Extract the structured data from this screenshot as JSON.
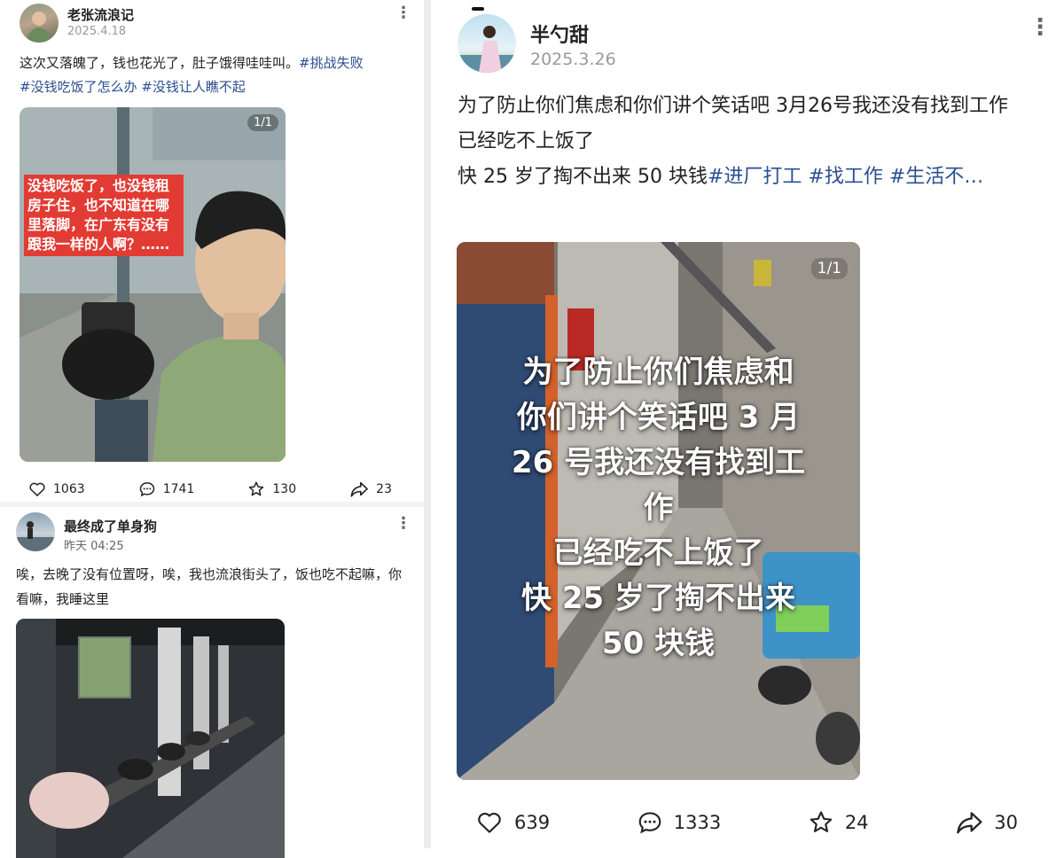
{
  "posts": [
    {
      "author": "老张流浪记",
      "date": "2025.4.18",
      "text": "这次又落魄了，钱也花光了，肚子饿得哇哇叫。",
      "tags": [
        "#挑战失败",
        "#没钱吃饭了怎么办",
        "#没钱让人瞧不起"
      ],
      "image_badge": "1/1",
      "image_overlay_text": "没钱吃饭了，也没钱租房子住，也不知道在哪里落脚，在广东有没有跟我一样的人啊？……",
      "likes": "1063",
      "comments": "1741",
      "favorites": "130",
      "shares": "23"
    },
    {
      "author": "最终成了单身狗",
      "date": "昨天 04:25",
      "text": "唉，去晚了没有位置呀，唉，我也流浪街头了，饭也吃不起嘛，你看嘛，我睡这里"
    },
    {
      "author": "半勺甜",
      "date": "2025.3.26",
      "text_line1": "为了防止你们焦虑和你们讲个笑话吧 3月26号我还没有找到工作",
      "text_line2": "已经吃不上饭了",
      "text_line3": "快 25 岁了掏不出来 50 块钱",
      "tags": [
        "#进厂打工",
        "#找工作",
        "#生活不…"
      ],
      "image_badge": "1/1",
      "image_overlay_lines": [
        "为了防止你们焦虑和",
        "你们讲个笑话吧 3 月",
        "26 号我还没有找到工",
        "作",
        "已经吃不上饭了",
        "快 25 岁了掏不出来",
        "50 块钱"
      ],
      "likes": "639",
      "comments": "1333",
      "favorites": "24",
      "shares": "30"
    }
  ],
  "icons": {
    "like": "heart-icon",
    "comment": "chat-bubble-icon",
    "favorite": "star-icon",
    "share": "share-arrow-icon",
    "more": "more-vertical-icon",
    "badge": "multi-image-icon"
  },
  "colors": {
    "hashtag": "#2b4f91",
    "overlay_red": "#e23b33",
    "date_gray": "#9a9a9a"
  }
}
